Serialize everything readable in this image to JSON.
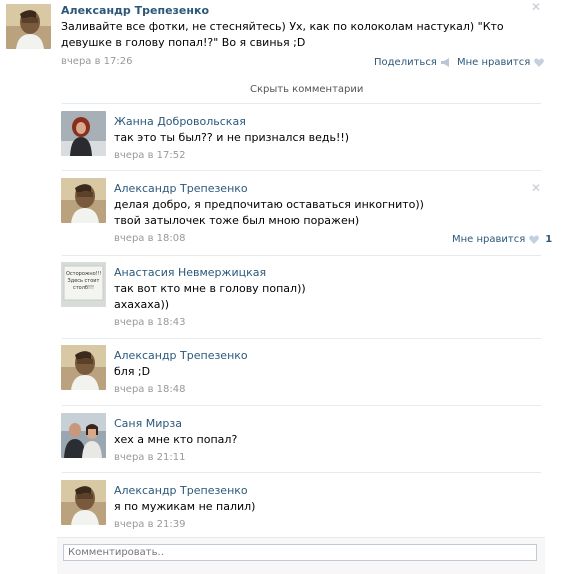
{
  "post": {
    "author": "Александр Трепезенко",
    "text": "Заливайте все фотки, не стесняйтесь) Ух, как по колоколам настукал) \"Кто девушке в голову попал!?\" Во я свинья ;D",
    "time": "вчера в 17:26",
    "share_label": "Поделиться",
    "like_label": "Мне нравится"
  },
  "hide_comments_label": "Скрыть комментарии",
  "comments": [
    {
      "author": "Жанна Добровольская",
      "lines": [
        "так это ты был?? и не признался ведь!!)"
      ],
      "time": "вчера в 17:52"
    },
    {
      "author": "Александр Трепезенко",
      "lines": [
        "делая добро, я предпочитаю оставаться инкогнито))",
        "твой затылочек тоже был мною поражен)"
      ],
      "time": "вчера в 18:08",
      "like_label": "Мне нравится",
      "like_count": "1"
    },
    {
      "author": "Анастасия Невмержицкая",
      "lines": [
        "так вот кто мне в голову попал))",
        "ахахаха))"
      ],
      "time": "вчера в 18:43",
      "avatar_text": "Осторожно!!! Здесь стоит столб!!!"
    },
    {
      "author": "Александр Трепезенко",
      "lines": [
        "бля ;D"
      ],
      "time": "вчера в 18:48"
    },
    {
      "author": "Саня Мирза",
      "lines": [
        "хех а мне кто попал?"
      ],
      "time": "вчера в 21:11"
    },
    {
      "author": "Александр Трепезенко",
      "lines": [
        "я по мужикам не палил)"
      ],
      "time": "вчера в 21:39"
    }
  ],
  "comment_input": {
    "placeholder": "Комментировать.."
  },
  "colors": {
    "link": "#2b587a",
    "time": "#999999",
    "divider": "#e7eaed",
    "input_border": "#c0cad5"
  },
  "icons": {
    "close": "close-icon",
    "share": "megaphone-icon",
    "like": "heart-icon"
  }
}
